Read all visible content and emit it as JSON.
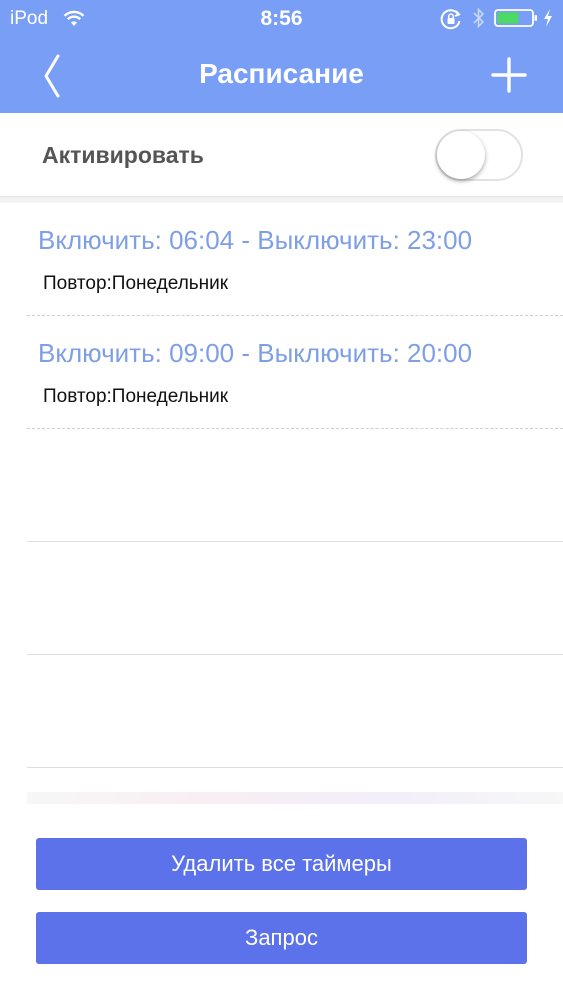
{
  "status_bar": {
    "carrier": "iPod",
    "time": "8:56",
    "battery_color": "#4cd964"
  },
  "header": {
    "title": "Расписание",
    "background_color": "#789ef5",
    "back_icon": "chevron-left-icon",
    "add_icon": "plus-icon"
  },
  "activate": {
    "label": "Активировать",
    "enabled": false
  },
  "timers": [
    {
      "title": "Включить: 06:04 - Выключить: 23:00",
      "repeat": "Повтор:Понедельник"
    },
    {
      "title": "Включить: 09:00 - Выключить: 20:00",
      "repeat": "Повтор:Понедельник"
    }
  ],
  "buttons": {
    "delete_all": "Удалить все таймеры",
    "query": "Запрос",
    "color": "#5b72ea"
  },
  "accent_text_color": "#7f9fe4"
}
